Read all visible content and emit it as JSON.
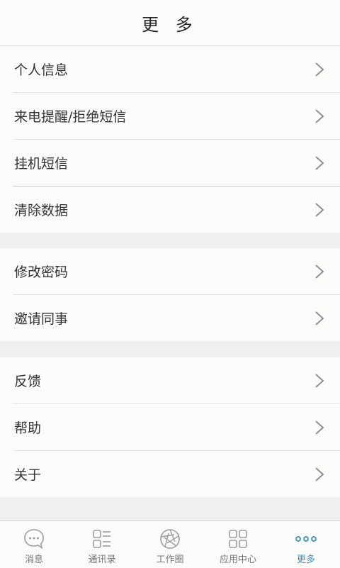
{
  "header": {
    "title": "更 多"
  },
  "groups": [
    {
      "items": [
        {
          "label": "个人信息"
        },
        {
          "label": "来电提醒/拒绝短信"
        },
        {
          "label": "挂机短信"
        },
        {
          "label": "清除数据"
        }
      ]
    },
    {
      "items": [
        {
          "label": "修改密码"
        },
        {
          "label": "邀请同事"
        }
      ]
    },
    {
      "items": [
        {
          "label": "反馈"
        },
        {
          "label": "帮助"
        },
        {
          "label": "关于"
        }
      ]
    }
  ],
  "tabbar": {
    "tabs": [
      {
        "label": "消息",
        "icon": "chat-bubble-icon"
      },
      {
        "label": "通讯录",
        "icon": "contacts-list-icon"
      },
      {
        "label": "工作圈",
        "icon": "aperture-icon"
      },
      {
        "label": "应用中心",
        "icon": "app-grid-icon"
      },
      {
        "label": "更多",
        "icon": "more-dots-icon"
      }
    ],
    "active_index": 4
  },
  "colors": {
    "accent": "#3a8fb8",
    "background": "#efefef",
    "surface": "#fbfbf9",
    "chevron": "#8e9097"
  }
}
